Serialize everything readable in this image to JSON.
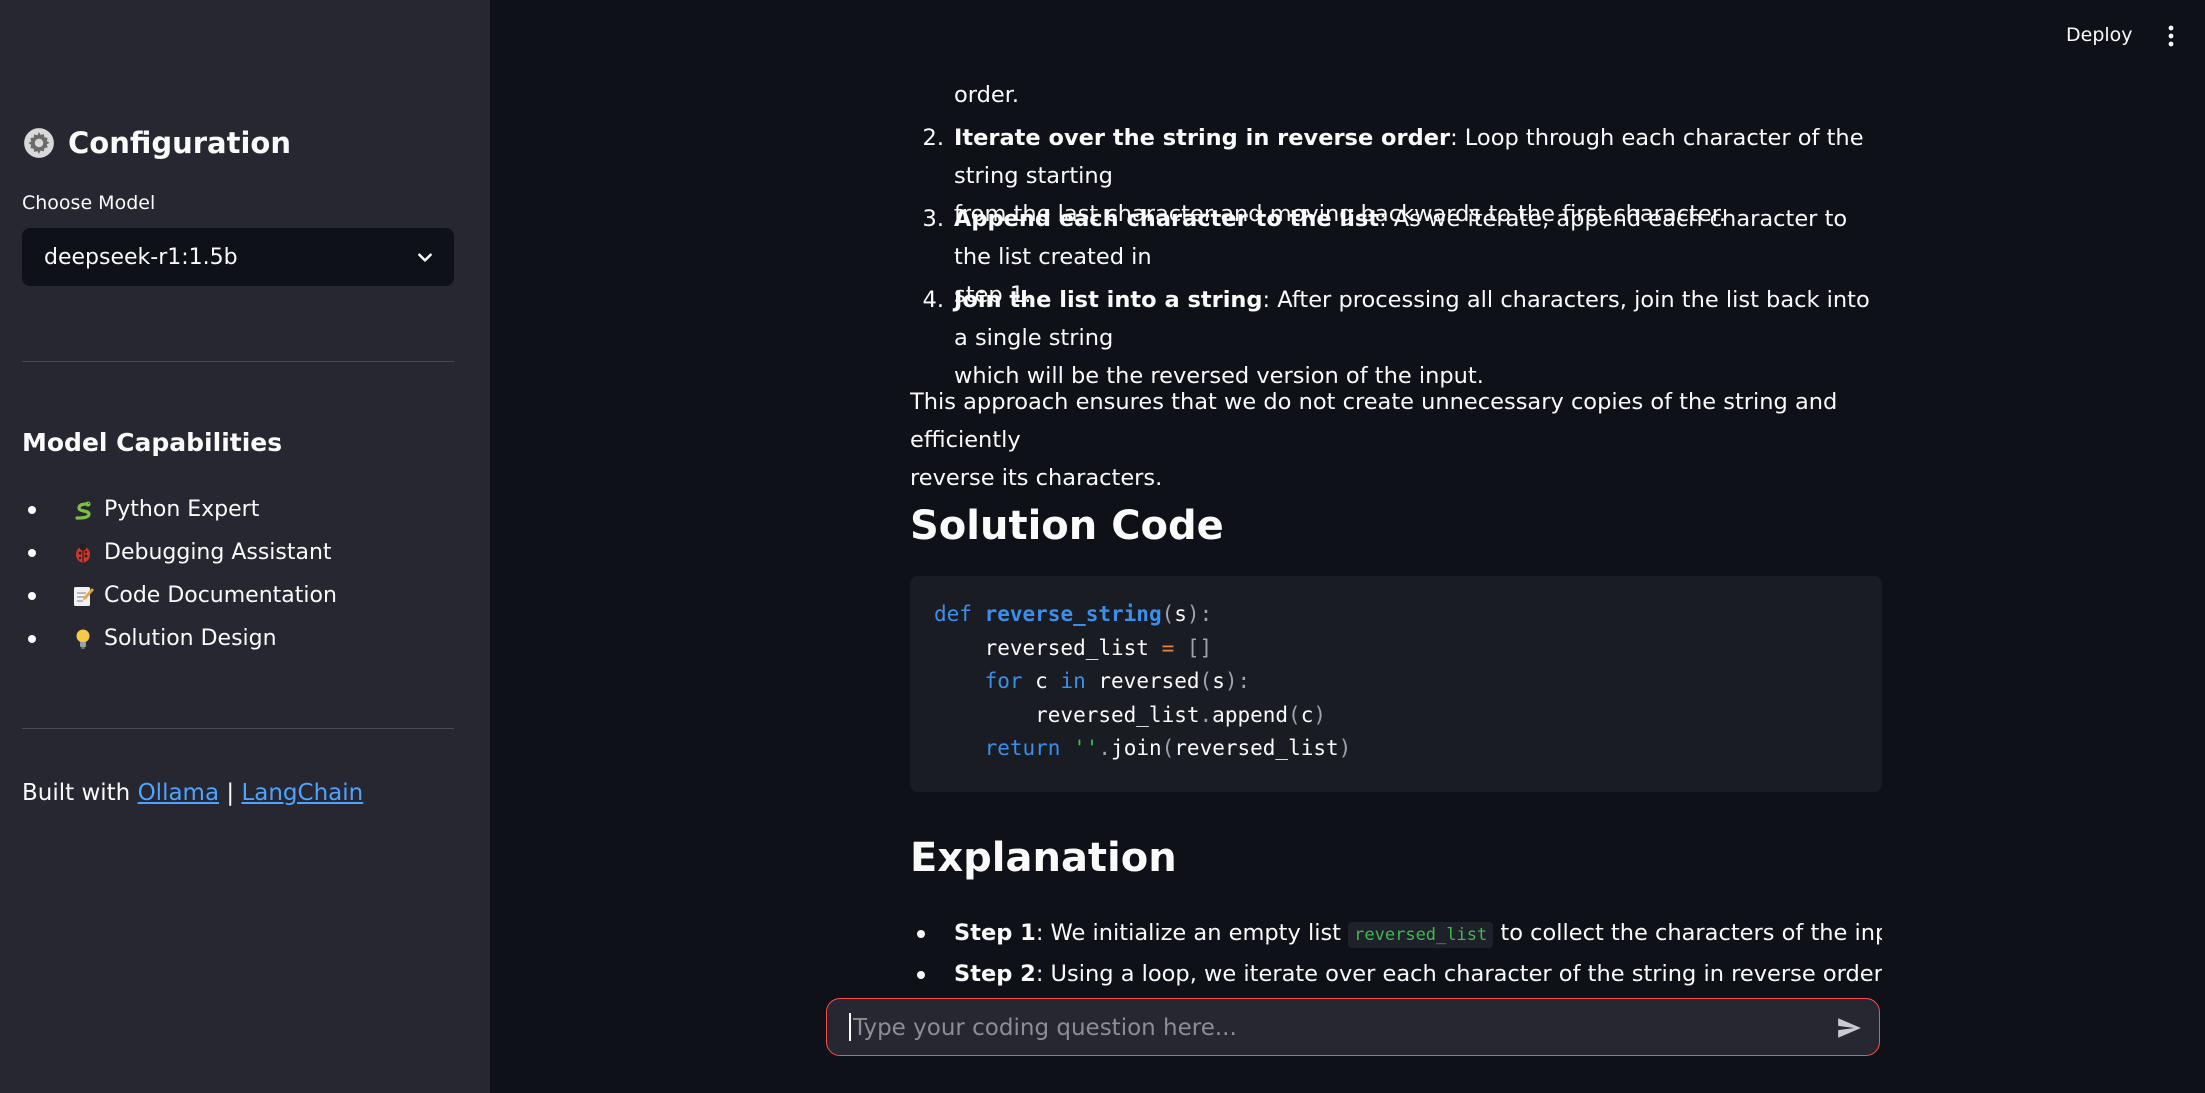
{
  "sidebar": {
    "title": "Configuration",
    "choose_model_label": "Choose Model",
    "selected_model": "deepseek-r1:1.5b",
    "capabilities_title": "Model Capabilities",
    "capabilities": [
      {
        "icon": "snake-icon",
        "label": "Python Expert"
      },
      {
        "icon": "bug-icon",
        "label": "Debugging Assistant"
      },
      {
        "icon": "memo-icon",
        "label": "Code Documentation"
      },
      {
        "icon": "lightbulb-icon",
        "label": "Solution Design"
      }
    ],
    "built_with_prefix": "Built with",
    "link_ollama": "Ollama",
    "separator": "|",
    "link_langchain": "LangChain"
  },
  "header": {
    "deploy_label": "Deploy"
  },
  "content": {
    "partial_line": "order.",
    "steps": [
      {
        "num": "2.",
        "bold": "Iterate over the string in reverse order",
        "line1": ": Loop through each character of the string starting",
        "line2": "from the last character and moving backwards to the first character."
      },
      {
        "num": "3.",
        "bold": "Append each character to the list",
        "line1": ": As we iterate, append each character to the list created in",
        "line2": "step 1."
      },
      {
        "num": "4.",
        "bold": "Join the list into a string",
        "line1": ": After processing all characters, join the list back into a single string",
        "line2": "which will be the reversed version of the input."
      }
    ],
    "paragraph_line1": "This approach ensures that we do not create unnecessary copies of the string and efficiently",
    "paragraph_line2": "reverse its characters.",
    "solution_heading": "Solution Code",
    "explanation_heading": "Explanation",
    "explanation_items": [
      {
        "bold": "Step 1",
        "pre": ": We initialize an empty list ",
        "code": "reversed_list",
        "post": " to collect the characters of the input string."
      },
      {
        "bold": "Step 2",
        "pre": ": Using a loop, we iterate over each character of the string in reverse order using",
        "code": "",
        "post": ""
      }
    ]
  },
  "chat": {
    "placeholder": "Type your coding question here...",
    "value": ""
  }
}
